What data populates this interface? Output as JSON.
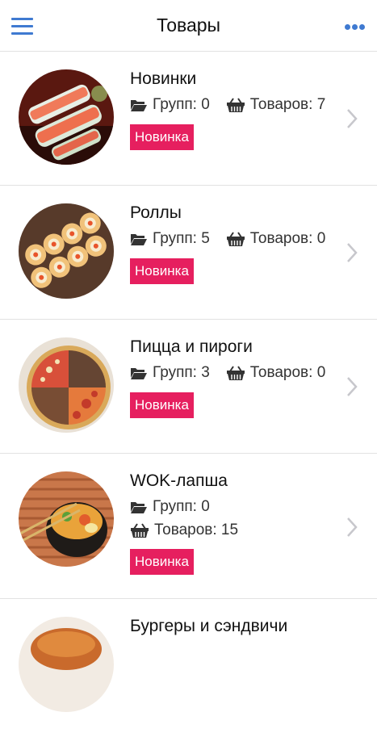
{
  "header": {
    "title": "Товары",
    "menu_icon": "hamburger-icon",
    "more_icon": "more-dots-icon"
  },
  "colors": {
    "accent": "#3f7ad1",
    "badge": "#e61f5f"
  },
  "categories": [
    {
      "name": "Новинки",
      "groups": "Групп: 0",
      "products": "Товаров: 7",
      "badge": "Новинка"
    },
    {
      "name": "Роллы",
      "groups": "Групп: 5",
      "products": "Товаров: 0",
      "badge": "Новинка"
    },
    {
      "name": "Пицца и пироги",
      "groups": "Групп: 3",
      "products": "Товаров: 0",
      "badge": "Новинка"
    },
    {
      "name": "WOK-лапша",
      "groups": "Групп: 0",
      "products": "Товаров: 15",
      "badge": "Новинка"
    },
    {
      "name": "Бургеры и сэндвичи"
    }
  ]
}
